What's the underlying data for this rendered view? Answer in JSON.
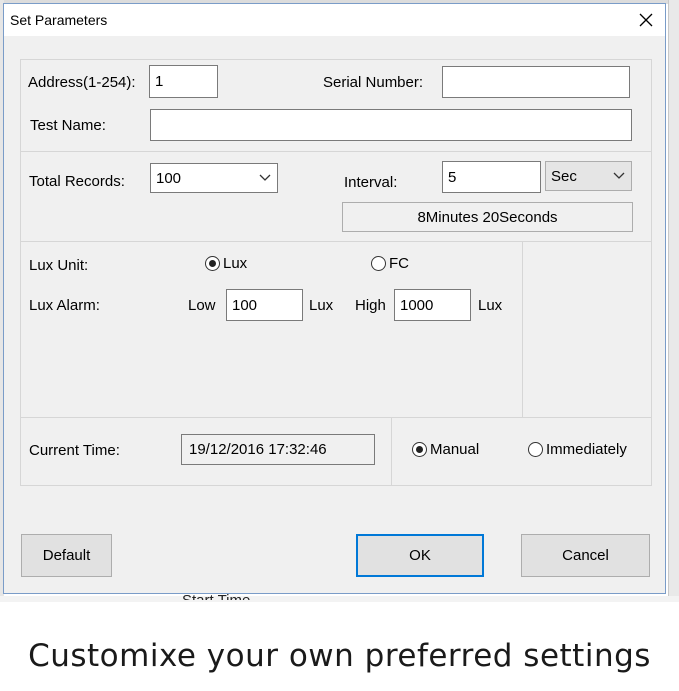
{
  "dialog": {
    "title": "Set Parameters",
    "close_icon": "close-icon"
  },
  "address": {
    "label": "Address(1-254):",
    "value": "1"
  },
  "serial_number": {
    "label": "Serial Number:",
    "value": ""
  },
  "test_name": {
    "label": "Test Name:",
    "value": ""
  },
  "total_records": {
    "label": "Total Records:",
    "value": "100"
  },
  "interval": {
    "label": "Interval:",
    "value": "5",
    "unit": "Sec"
  },
  "duration_readout": "8Minutes 20Seconds",
  "lux_unit": {
    "label": "Lux Unit:",
    "options": [
      {
        "label": "Lux",
        "selected": true
      },
      {
        "label": "FC",
        "selected": false
      }
    ]
  },
  "lux_alarm": {
    "label": "Lux Alarm:",
    "low_label": "Low",
    "low_value": "100",
    "low_unit": "Lux",
    "high_label": "High",
    "high_value": "1000",
    "high_unit": "Lux"
  },
  "current_time": {
    "label": "Current Time:",
    "value": "19/12/2016 17:32:46",
    "modes": [
      {
        "label": "Manual",
        "selected": true
      },
      {
        "label": "Immediately",
        "selected": false
      }
    ]
  },
  "buttons": {
    "default": "Default",
    "ok": "OK",
    "cancel": "Cancel"
  },
  "background_peek": "Start Time",
  "caption": "Customixe your own preferred settings",
  "colors": {
    "focus_border": "#0078d7",
    "dialog_bg": "#f0f0f0",
    "window_border": "#7a9cc8"
  }
}
